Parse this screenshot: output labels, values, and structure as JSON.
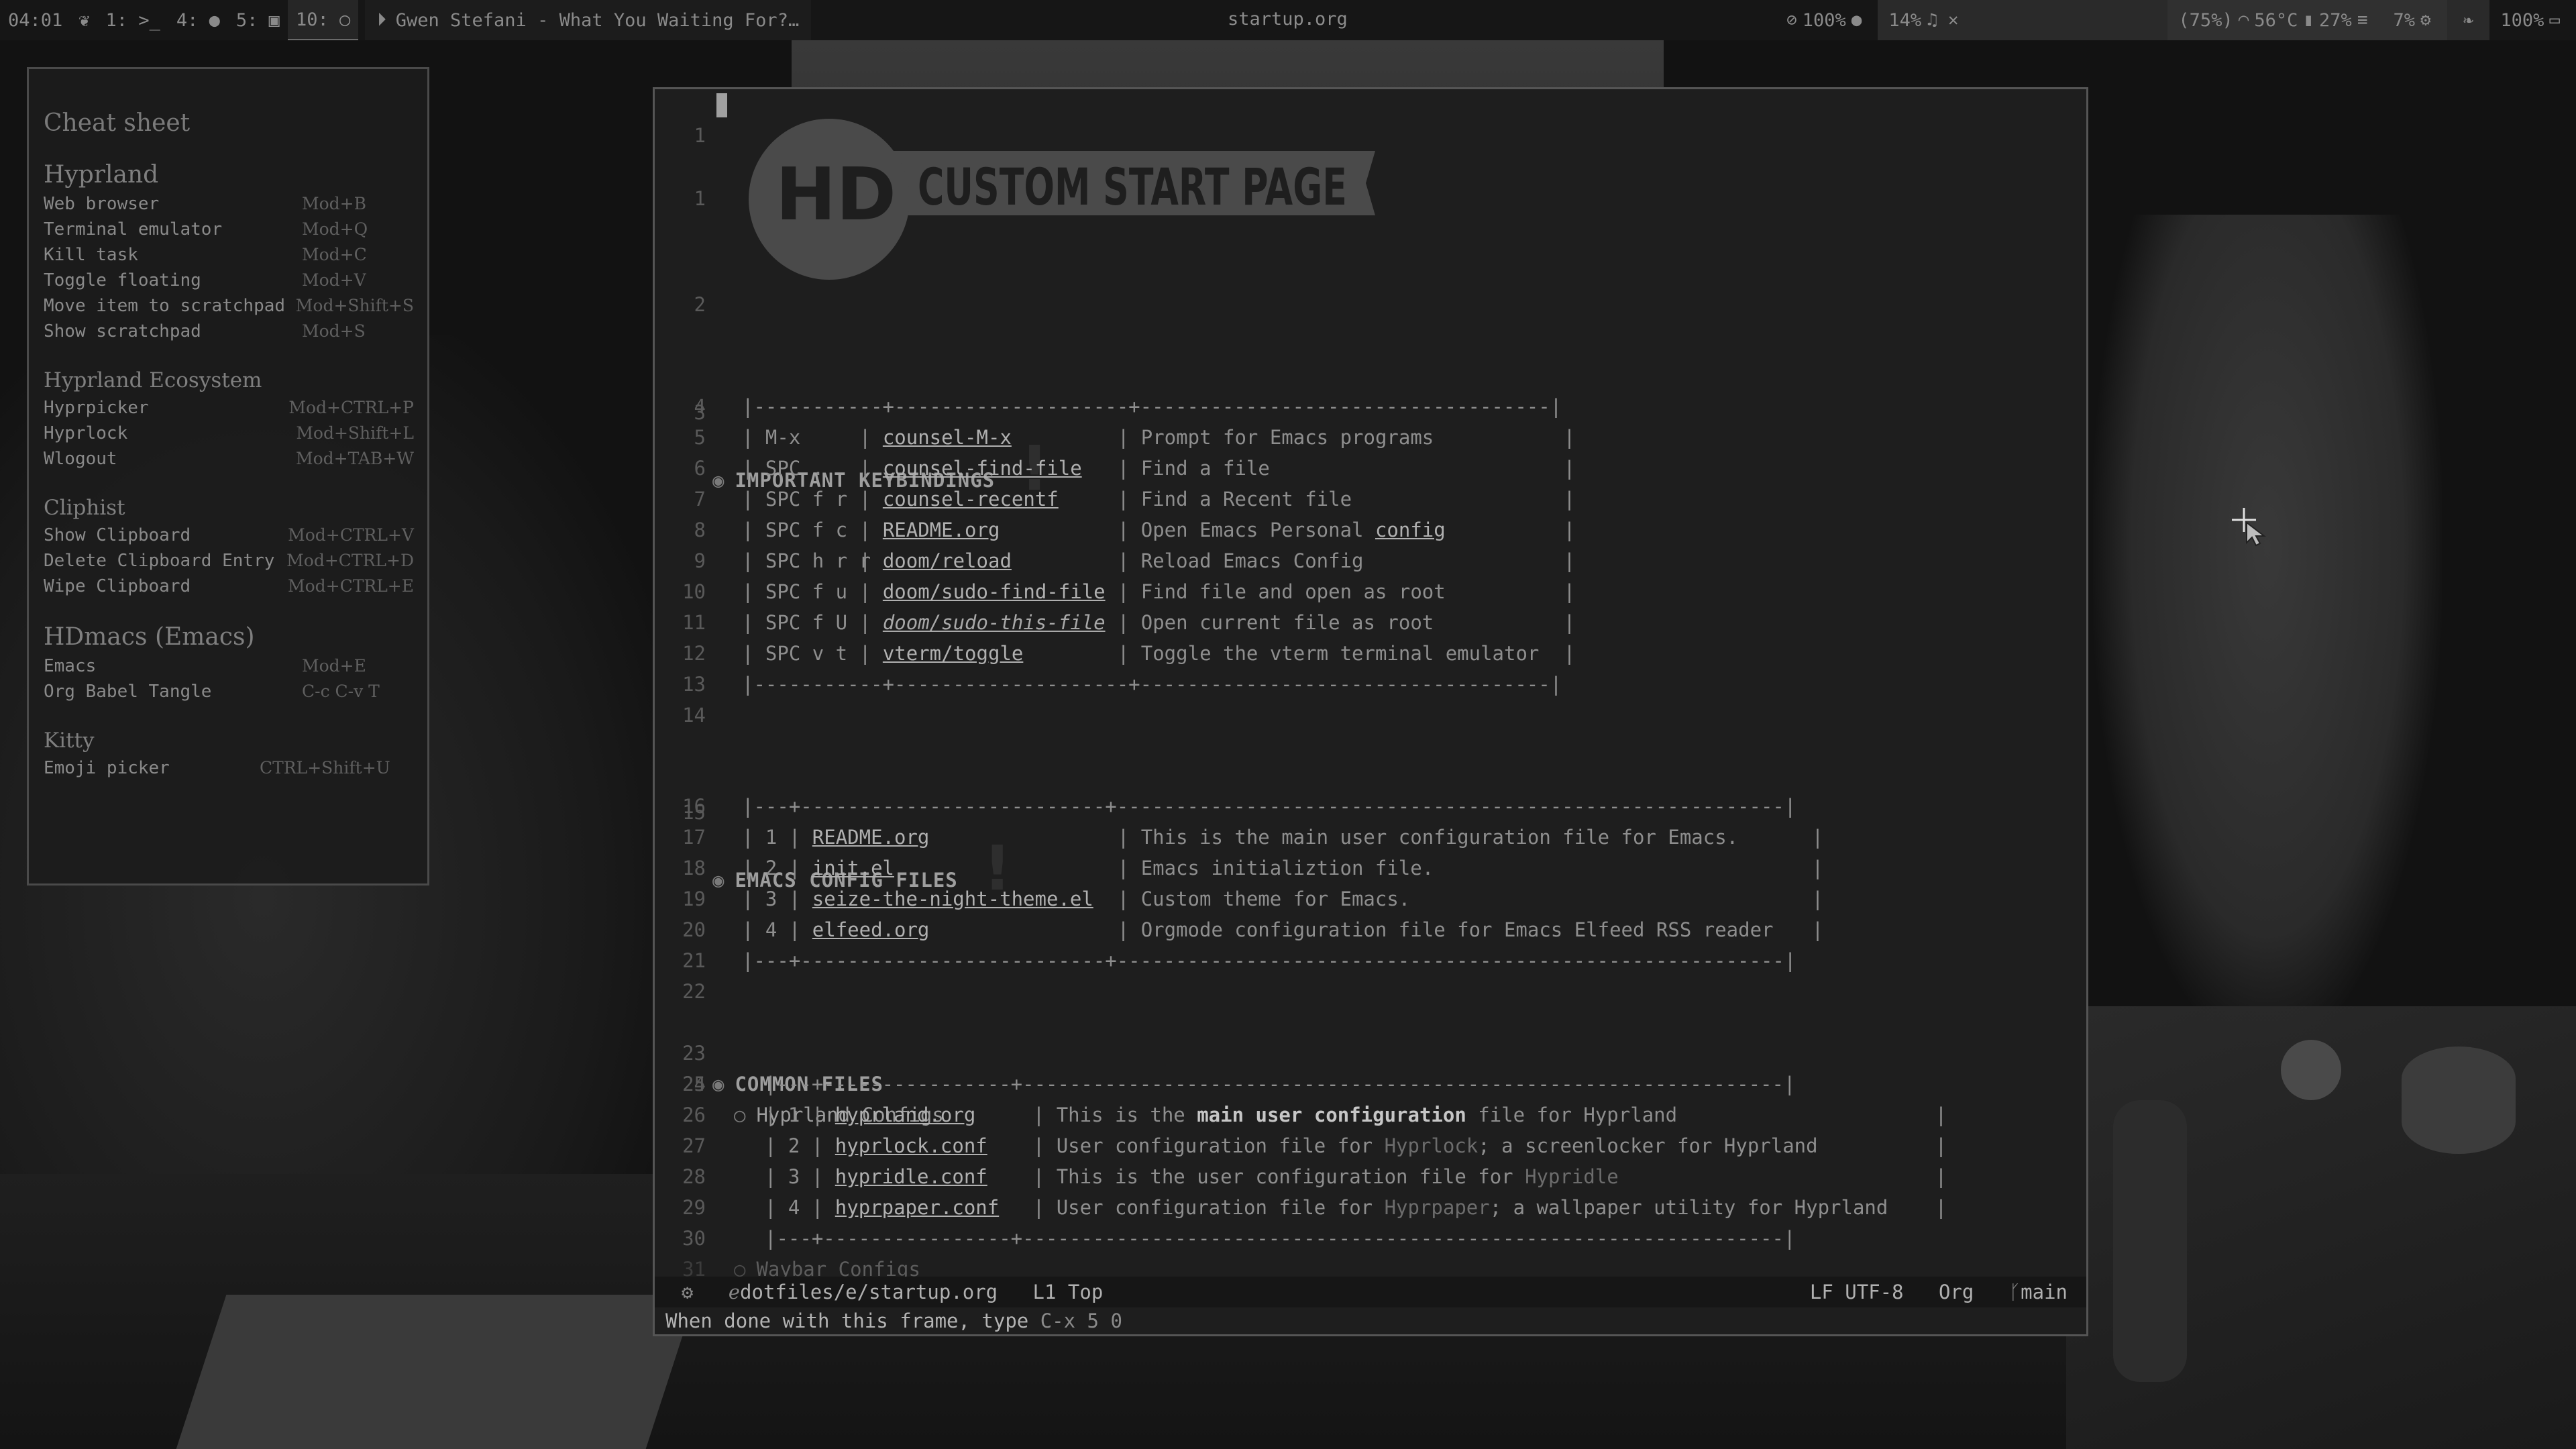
{
  "topbar": {
    "time": "04:01",
    "workspaces": [
      {
        "num": "1:",
        "icon": "terminal-icon",
        "glyph": ">_"
      },
      {
        "num": "4:",
        "icon": "chat-icon",
        "glyph": "●"
      },
      {
        "num": "5:",
        "icon": "window-icon",
        "glyph": "▣"
      },
      {
        "num": "10:",
        "icon": "circle-icon",
        "glyph": "○"
      }
    ],
    "media": "Gwen Stefani - What You Waiting For?…",
    "window_title": "startup.org",
    "status": {
      "brightness": "100%",
      "volume": "14%",
      "battery": "(75%)",
      "temp": "56°C",
      "cpu": "27%",
      "memory": "7%",
      "power": "100%"
    }
  },
  "cheat": {
    "title": "Cheat sheet",
    "hyprland": {
      "title": "Hyprland",
      "rows": [
        {
          "k": "Web browser",
          "v": "Mod+B"
        },
        {
          "k": "Terminal emulator",
          "v": "Mod+Q"
        },
        {
          "k": "Kill task",
          "v": "Mod+C"
        },
        {
          "k": "Toggle floating",
          "v": "Mod+V"
        },
        {
          "k": "Move item to scratchpad",
          "v": "Mod+Shift+S"
        },
        {
          "k": "Show scratchpad",
          "v": "Mod+S"
        }
      ]
    },
    "ecosystem": {
      "title": "Hyprland Ecosystem",
      "rows": [
        {
          "k": "Hyprpicker",
          "v": "Mod+CTRL+P"
        },
        {
          "k": "Hyprlock",
          "v": "Mod+Shift+L"
        },
        {
          "k": "Wlogout",
          "v": "Mod+TAB+W"
        }
      ]
    },
    "cliphist": {
      "title": "Cliphist",
      "rows": [
        {
          "k": "Show Clipboard",
          "v": "Mod+CTRL+V"
        },
        {
          "k": "Delete Clipboard Entry",
          "v": "Mod+CTRL+D"
        },
        {
          "k": "Wipe Clipboard",
          "v": "Mod+CTRL+E"
        }
      ]
    },
    "hdmacs": {
      "title": "HDmacs (Emacs)",
      "rows": [
        {
          "k": "Emacs",
          "v": "Mod+E"
        },
        {
          "k": "Org Babel Tangle",
          "v": "C-c C-v T"
        }
      ]
    },
    "kitty": {
      "title": "Kitty",
      "rows": [
        {
          "k": "Emoji picker",
          "v": "CTRL+Shift+U"
        }
      ]
    }
  },
  "emacs": {
    "banner": {
      "logo": "HD",
      "text": "CUSTOM START PAGE"
    },
    "headings": {
      "keybindings": "IMPORTANT KEYBINDINGS",
      "config": "EMACS CONFIG FILES",
      "common": "COMMON FILES",
      "hyprland_configs": "Hyprland Configs",
      "waybar_configs": "Waybar Configs"
    },
    "keybindings": [
      {
        "key": "M-x",
        "cmd": "counsel-M-x",
        "desc": "Prompt for Emacs programs"
      },
      {
        "key": "SPC .",
        "cmd": "counsel-find-file",
        "desc": "Find a file"
      },
      {
        "key": "SPC f r",
        "cmd": "counsel-recentf",
        "desc": "Find a Recent file"
      },
      {
        "key": "SPC f c",
        "cmd": "README.org",
        "desc": "Open Emacs Personal ",
        "desc_link": "config"
      },
      {
        "key": "SPC h r r",
        "cmd": "doom/reload",
        "desc": "Reload Emacs Config"
      },
      {
        "key": "SPC f u",
        "cmd": "doom/sudo-find-file",
        "desc": "Find file and open as root"
      },
      {
        "key": "SPC f U",
        "cmd": "doom/sudo-this-file",
        "desc": "Open current file as root"
      },
      {
        "key": "SPC v t",
        "cmd": "vterm/toggle",
        "desc": "Toggle the vterm terminal emulator"
      }
    ],
    "config_files": [
      {
        "n": "1",
        "file": "README.org",
        "desc": "This is the main user configuration file for Emacs."
      },
      {
        "n": "2",
        "file": "init.el",
        "desc": "Emacs initializtion file."
      },
      {
        "n": "3",
        "file": "seize-the-night-theme.el",
        "desc": "Custom theme for Emacs."
      },
      {
        "n": "4",
        "file": "elfeed.org",
        "desc": "Orgmode configuration file for Emacs Elfeed RSS reader"
      }
    ],
    "hypr_files": [
      {
        "n": "1",
        "file": "hyprland.org",
        "pre": "This is the ",
        "bold": "main user configuration",
        "post": " file for Hyprland"
      },
      {
        "n": "2",
        "file": "hyprlock.conf",
        "pre": "User configuration file for ",
        "dim": "Hyprlock",
        "post": "; a screenlocker for Hyprland"
      },
      {
        "n": "3",
        "file": "hypridle.conf",
        "pre": "This is the user configuration file for ",
        "dim": "Hypridle",
        "post": ""
      },
      {
        "n": "4",
        "file": "hyprpaper.conf",
        "pre": "User configuration file for ",
        "dim": "Hyprpaper",
        "post": "; a wallpaper utility for Hyprland"
      }
    ],
    "modeline": {
      "path": "dotfiles/e/startup.org",
      "position": "L1 Top",
      "encoding": "LF UTF-8",
      "mode": "Org",
      "branch": "main"
    },
    "echo": {
      "text": "When done with this frame, type ",
      "key": "C-x 5 0"
    }
  }
}
